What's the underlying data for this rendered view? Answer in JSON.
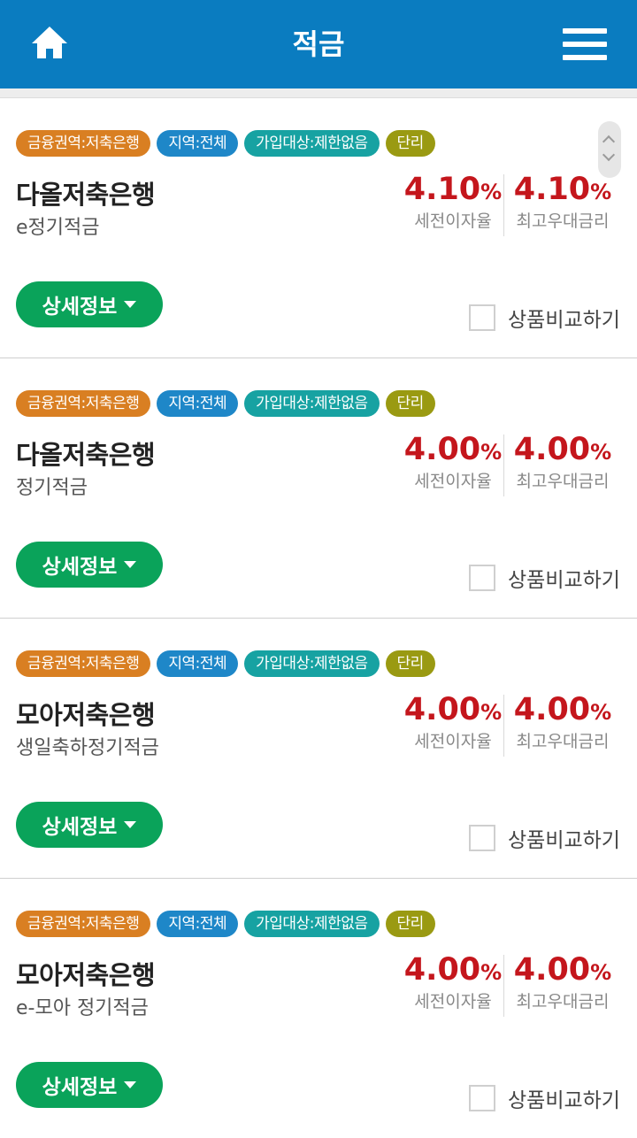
{
  "header": {
    "title": "적금"
  },
  "colors": {
    "header_bg": "#0a7cc0",
    "tag_region": "#d97f22",
    "tag_area": "#1e87c8",
    "tag_target": "#17a2a2",
    "tag_interest": "#9a9a12",
    "rate": "#c4161c",
    "detail_button": "#0aa35a"
  },
  "products": [
    {
      "tags": [
        "금융권역:저축은행",
        "지역:전체",
        "가입대상:제한없음",
        "단리"
      ],
      "bank": "다올저축은행",
      "product": "e정기적금",
      "base_rate": "4.10",
      "base_unit": "%",
      "base_label": "세전이자율",
      "max_rate": "4.10",
      "max_unit": "%",
      "max_label": "최고우대금리",
      "detail_label": "상세정보",
      "compare_label": "상품비교하기"
    },
    {
      "tags": [
        "금융권역:저축은행",
        "지역:전체",
        "가입대상:제한없음",
        "단리"
      ],
      "bank": "다올저축은행",
      "product": "정기적금",
      "base_rate": "4.00",
      "base_unit": "%",
      "base_label": "세전이자율",
      "max_rate": "4.00",
      "max_unit": "%",
      "max_label": "최고우대금리",
      "detail_label": "상세정보",
      "compare_label": "상품비교하기"
    },
    {
      "tags": [
        "금융권역:저축은행",
        "지역:전체",
        "가입대상:제한없음",
        "단리"
      ],
      "bank": "모아저축은행",
      "product": "생일축하정기적금",
      "base_rate": "4.00",
      "base_unit": "%",
      "base_label": "세전이자율",
      "max_rate": "4.00",
      "max_unit": "%",
      "max_label": "최고우대금리",
      "detail_label": "상세정보",
      "compare_label": "상품비교하기"
    },
    {
      "tags": [
        "금융권역:저축은행",
        "지역:전체",
        "가입대상:제한없음",
        "단리"
      ],
      "bank": "모아저축은행",
      "product": "e-모아 정기적금",
      "base_rate": "4.00",
      "base_unit": "%",
      "base_label": "세전이자율",
      "max_rate": "4.00",
      "max_unit": "%",
      "max_label": "최고우대금리",
      "detail_label": "상세정보",
      "compare_label": "상품비교하기"
    }
  ]
}
